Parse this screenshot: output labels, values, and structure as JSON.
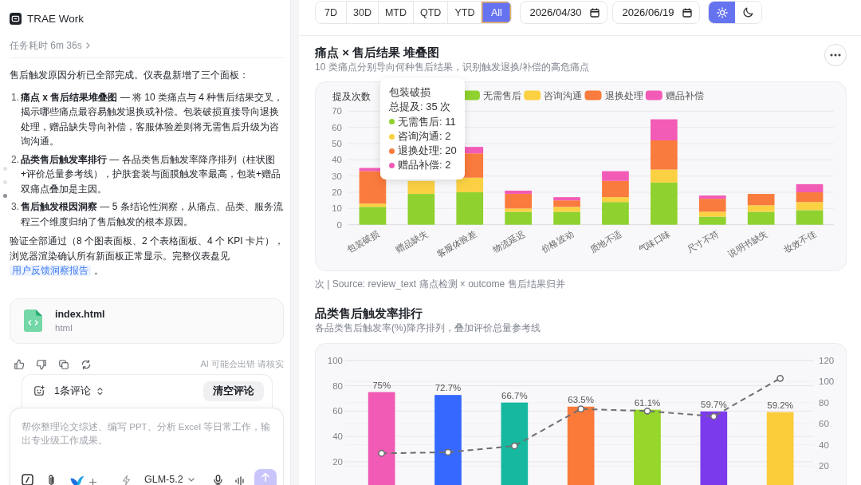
{
  "chat": {
    "app_title": "TRAE Work",
    "task_time": "任务耗时 6m 36s",
    "nav_dots": [
      {
        "selected": false
      },
      {
        "selected": false
      },
      {
        "selected": true
      }
    ],
    "intro": "售后触发原因分析已全部完成。仪表盘新增了三个面板：",
    "list": [
      {
        "number": "1.",
        "text": "**痛点 x 售后结果堆叠图** — 将 10 类痛点与 4 种售后结果交叉，揭示哪些痛点最容易触发退换或补偿。包装破损直接导向退换处理，赠品缺失导向补偿，客服体验差则将无需售后升级为咨询沟通。"
      },
      {
        "number": "2.",
        "text": "**品类售后触发率排行** — 各品类售后触发率降序排列（柱状图+评价总量参考线），护肤套装与面膜触发率最高，包装+赠品双痛点叠加是主因。"
      },
      {
        "number": "3.",
        "text": "**售后触发根因洞察** — 5 条结论性洞察，从痛点、品类、服务流程三个维度归纳了售后触发的根本原因。"
      }
    ],
    "outro": "验证全部通过（8 个图表面板、2 个表格面板、4 个 KPI 卡片），浏览器渲染确认所有新面板正常显示。完整仪表盘见",
    "link": "用户反馈洞察报告",
    "outro_end": "。",
    "file": {
      "name": "index.html",
      "type": "html"
    },
    "disclaimer": "AI 可能会出错 请核实",
    "comments": {
      "count": "1条评论",
      "clear_button": "清空评论"
    },
    "composer": {
      "placeholder": "帮你整理论文综述、编写 PPT、分析 Excel 等日常工作，输出专业级工作成果。",
      "model": "GLM-5.2"
    }
  },
  "toolbar": {
    "ranges": [
      {
        "label": "7D",
        "selected": false
      },
      {
        "label": "30D",
        "selected": false
      },
      {
        "label": "MTD",
        "selected": false
      },
      {
        "label": "QTD",
        "selected": false
      },
      {
        "label": "YTD",
        "selected": false
      },
      {
        "label": "All",
        "selected": true
      }
    ],
    "date_from": "2026/04/30",
    "date_to": "2026/06/19",
    "theme_modes": [
      {
        "kind": "light",
        "selected": true
      },
      {
        "kind": "dark",
        "selected": false
      }
    ]
  },
  "panels": [
    {
      "title": "痛点 × 售后结果 堆叠图",
      "subtitle": "10 类痛点分别导向何种售后结果，识别触发退换/补偿的高危痛点",
      "has_menu": true,
      "chart_data": {
        "type": "bar",
        "stacked": true,
        "grid": true,
        "legend": "top",
        "ylabel": "提及次数",
        "categories": [
          "包装破损",
          "赠品缺失",
          "客服体验差",
          "物流延迟",
          "价格波动",
          "质地不适",
          "气味口味",
          "尺寸不符",
          "说明书缺失",
          "妆效不佳"
        ],
        "ylim": [
          0,
          70
        ],
        "yticks": [
          0,
          10,
          20,
          30,
          40,
          50,
          60,
          70
        ],
        "series": [
          {
            "name": "无需售后",
            "color": "#8fd12f",
            "values": [
              11,
              19,
              20,
              8,
              8,
              14,
              26,
              5,
              8,
              9
            ]
          },
          {
            "name": "咨询沟通",
            "color": "#fbd143",
            "values": [
              2,
              8,
              9,
              2,
              3,
              3,
              8,
              3,
              4,
              5
            ]
          },
          {
            "name": "退换处理",
            "color": "#f97b3d",
            "values": [
              20,
              null,
              15,
              9,
              4,
              10,
              18,
              8,
              7,
              6
            ]
          },
          {
            "name": "赠品补偿",
            "color": "#f25cb6",
            "values": [
              2,
              null,
              4,
              2,
              2,
              6,
              13,
              2,
              0,
              5
            ]
          }
        ]
      },
      "tooltip": {
        "title": "包装破损",
        "total": "总提及: 35 次",
        "items": [
          {
            "label": "无需售后: 11",
            "color": "#8fd12f"
          },
          {
            "label": "咨询沟通: 2",
            "color": "#fbd143"
          },
          {
            "label": "退换处理: 20",
            "color": "#f97b3d"
          },
          {
            "label": "赠品补偿: 2",
            "color": "#f25cb6"
          }
        ]
      },
      "footnote": "次 | Source: review_text 痛点检测 × outcome 售后结果归并"
    },
    {
      "title": "品类售后触发率排行",
      "subtitle": "各品类售后触发率(%)降序排列，叠加评价总量参考线",
      "chart_data": {
        "type": "bar",
        "grid": true,
        "ylim": [
          0,
          100
        ],
        "yticks": [
          20,
          40,
          60,
          80,
          100
        ],
        "y2lim": [
          0,
          120
        ],
        "y2ticks": [
          20,
          40,
          60,
          80,
          100,
          120
        ],
        "value_labels": [
          "75%",
          "72.7%",
          "66.7%",
          "63.5%",
          "61.1%",
          "59.7%",
          "59.2%"
        ],
        "series": [
          {
            "type": "bar",
            "colors": [
              "#f15bb5",
              "#3568ff",
              "#16b89f",
              "#fb7a3a",
              "#97d62b",
              "#7c3aed",
              "#fbcd3b"
            ],
            "values": [
              75,
              72.7,
              66.7,
              63.5,
              61.1,
              59.7,
              59.2
            ]
          },
          {
            "type": "line",
            "axis": "y2",
            "line_style": "dashed",
            "marker": "circle",
            "color": "#6e6e73",
            "values": [
              32,
              33,
              39,
              74,
              72,
              67,
              103
            ]
          }
        ]
      }
    }
  ]
}
